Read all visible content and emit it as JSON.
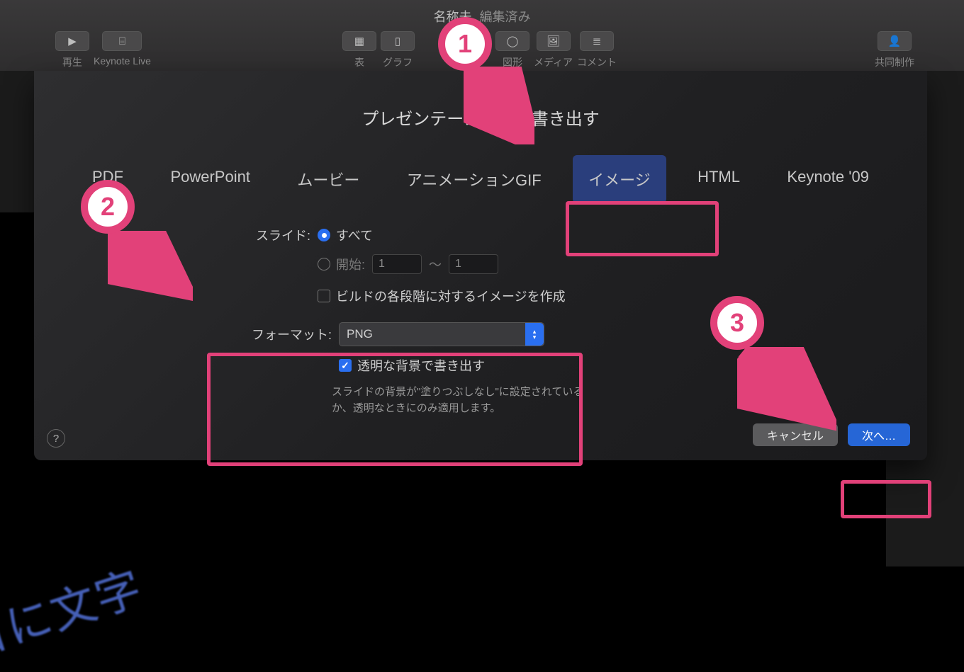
{
  "title": {
    "name": "名称未",
    "edited": "編集済み"
  },
  "toolbar": {
    "play": "再生",
    "live": "Keynote Live",
    "table": "表",
    "chart": "グラフ",
    "shape": "図形",
    "media": "メディア",
    "comment": "コメント",
    "collab": "共同制作"
  },
  "dialog": {
    "title": "プレゼンテーションを書き出す",
    "tabs": [
      "PDF",
      "PowerPoint",
      "ムービー",
      "アニメーションGIF",
      "イメージ",
      "HTML",
      "Keynote '09"
    ],
    "selected_tab": "イメージ",
    "slide_label": "スライド:",
    "slide_all": "すべて",
    "slide_range": "開始:",
    "from": "1",
    "tilde": "〜",
    "to": "1",
    "build_each": "ビルドの各段階に対するイメージを作成",
    "format_label": "フォーマット:",
    "format_value": "PNG",
    "transparent": "透明な背景で書き出す",
    "hint": "スライドの背景が\"塗りつぶしなし\"に設定されているか、透明なときにのみ適用します。",
    "cancel": "キャンセル",
    "next": "次へ…"
  },
  "rot_text": "日に文字",
  "ann": {
    "n1": "1",
    "n2": "2",
    "n3": "3"
  }
}
